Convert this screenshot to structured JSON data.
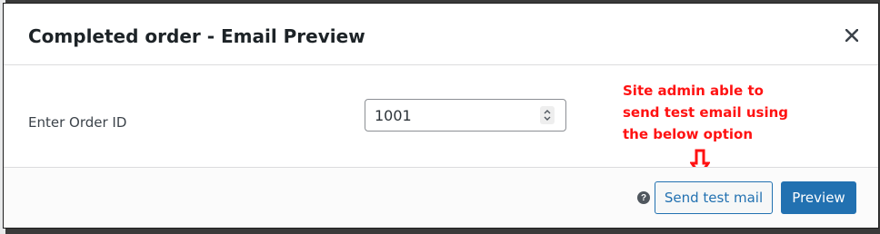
{
  "modal": {
    "title": "Completed order - Email Preview",
    "close_icon": "close-icon"
  },
  "form": {
    "order_id_label": "Enter Order ID",
    "order_id_value": "1001"
  },
  "annotation": {
    "lines": [
      "Site admin able to",
      "send test email using",
      "the below option"
    ],
    "color": "#ff1212"
  },
  "footer": {
    "help_icon": "question-circle-icon",
    "help_glyph": "?",
    "send_test_label": "Send test mail",
    "preview_label": "Preview"
  },
  "colors": {
    "accent": "#2271b1",
    "overlay": "#3a3a3a"
  }
}
